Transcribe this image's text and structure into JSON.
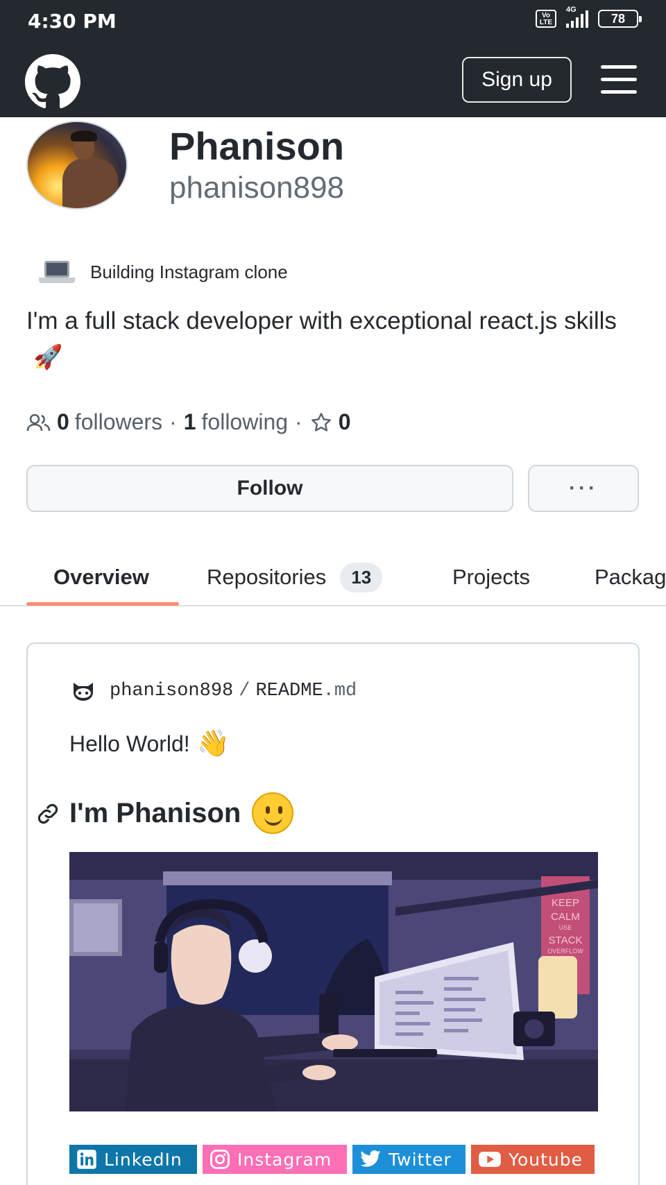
{
  "status_bar": {
    "time": "4:30 PM",
    "volte": "Vo LTE",
    "network": "4G",
    "battery": "78"
  },
  "header": {
    "signup_label": "Sign up"
  },
  "profile": {
    "name": "Phanison",
    "login": "phanison898",
    "status_message": "Building Instagram clone",
    "bio": "I'm a full stack developer with exceptional react.js skills",
    "followers_count": "0",
    "followers_label": "followers",
    "following_count": "1",
    "following_label": "following",
    "stars_count": "0",
    "follow_label": "Follow",
    "more_label": "···"
  },
  "tabs": [
    {
      "label": "Overview",
      "active": true
    },
    {
      "label": "Repositories",
      "count": "13"
    },
    {
      "label": "Projects"
    },
    {
      "label": "Packages"
    }
  ],
  "readme": {
    "owner": "phanison898",
    "separator": "/",
    "file_name": "README",
    "file_ext": ".md",
    "hello": "Hello World!",
    "heading": "I'm Phanison",
    "poster_text": [
      "KEEP",
      "CALM",
      "USE",
      "STACK",
      "OVERFLOW"
    ],
    "badges": [
      {
        "label": "LinkedIn",
        "color": "#0e76a8"
      },
      {
        "label": "Instagram",
        "color": "#ff6fb5"
      },
      {
        "label": "Twitter",
        "color": "#1c8fd8"
      },
      {
        "label": "Youtube",
        "color": "#e05d44"
      }
    ]
  },
  "colors": {
    "header_bg": "#24292f",
    "tab_underline": "#fd8c73",
    "muted_text": "#57606a"
  }
}
